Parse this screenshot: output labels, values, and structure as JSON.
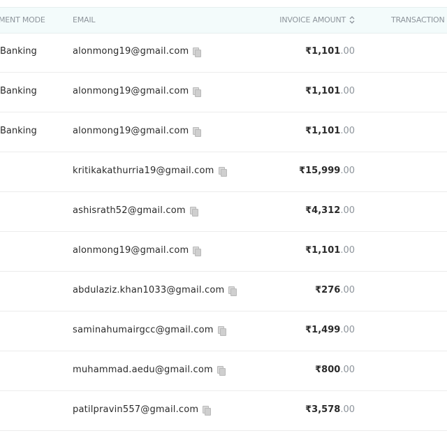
{
  "header": {
    "payment_mode": "MENT MODE",
    "email": "EMAIL",
    "invoice_amount": "INVOICE AMOUNT",
    "sort_icon": "sort-updown",
    "transaction": "TRANSACTION A"
  },
  "rows": [
    {
      "mode": "Banking",
      "email": "alonmong19@gmail.com",
      "amount": "₹1,101",
      "decimals": ".00"
    },
    {
      "mode": "Banking",
      "email": "alonmong19@gmail.com",
      "amount": "₹1,101",
      "decimals": ".00"
    },
    {
      "mode": "Banking",
      "email": "alonmong19@gmail.com",
      "amount": "₹1,101",
      "decimals": ".00"
    },
    {
      "mode": "",
      "email": "kritikakathurria19@gmail.com",
      "amount": "₹15,999",
      "decimals": ".00"
    },
    {
      "mode": "",
      "email": "ashisrath52@gmail.com",
      "amount": "₹4,312",
      "decimals": ".00"
    },
    {
      "mode": "",
      "email": "alonmong19@gmail.com",
      "amount": "₹1,101",
      "decimals": ".00"
    },
    {
      "mode": "",
      "email": "abdulaziz.khan1033@gmail.com",
      "amount": "₹276",
      "decimals": ".00"
    },
    {
      "mode": "",
      "email": "saminahumairgcc@gmail.com",
      "amount": "₹1,499",
      "decimals": ".00"
    },
    {
      "mode": "",
      "email": "muhammad.aedu@gmail.com",
      "amount": "₹800",
      "decimals": ".00"
    },
    {
      "mode": "",
      "email": "patilpravin557@gmail.com",
      "amount": "₹3,578",
      "decimals": ".00"
    }
  ]
}
